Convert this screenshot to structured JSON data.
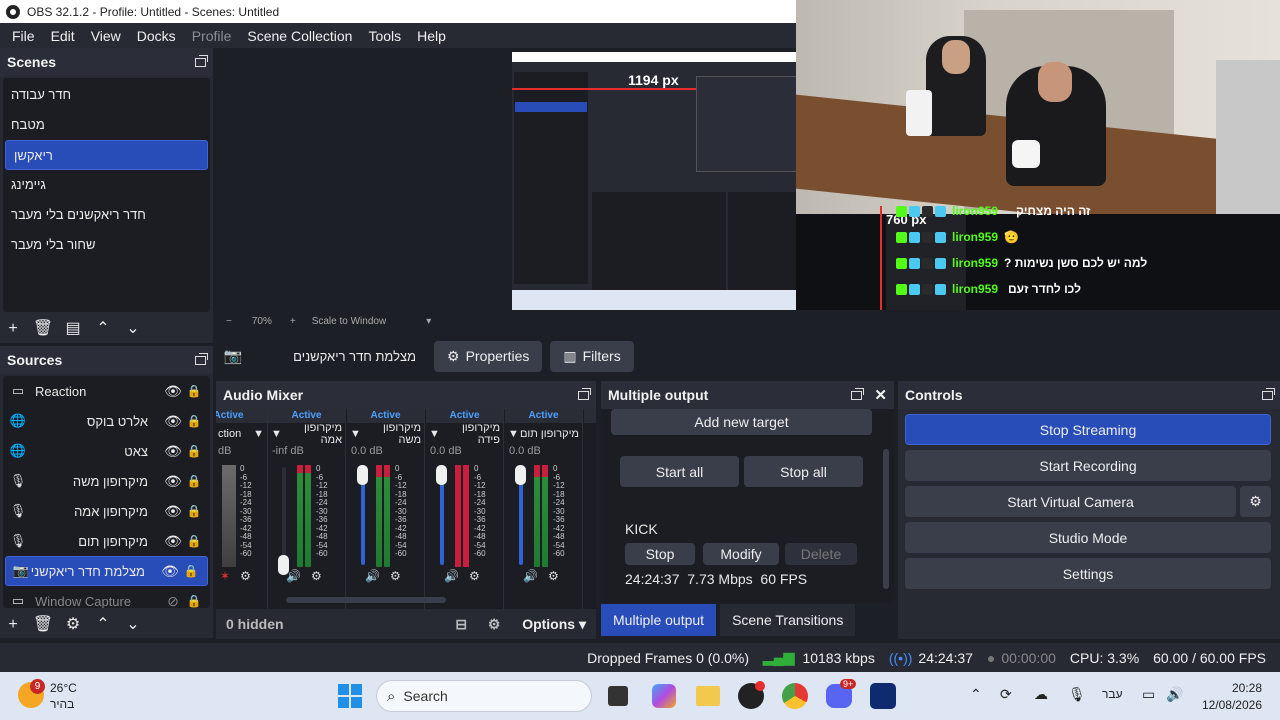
{
  "window": {
    "title": "OBS 32.1.2 - Profile: Untitled - Scenes: Untitled"
  },
  "menu": [
    "File",
    "Edit",
    "View",
    "Docks",
    "Profile",
    "Scene Collection",
    "Tools",
    "Help"
  ],
  "scenes": {
    "title": "Scenes",
    "items": [
      "חדר עבודה",
      "מטבח",
      "ריאקשן",
      "גיימינג",
      "חדר ריאקשנים בלי מעבר",
      "שחור בלי מעבר"
    ],
    "selected": 2
  },
  "sources": {
    "title": "Sources",
    "items": [
      {
        "name": "Reaction",
        "icon": "window-icon"
      },
      {
        "name": "אלרט בוקס",
        "icon": "globe-icon"
      },
      {
        "name": "צאט",
        "icon": "globe-icon"
      },
      {
        "name": "מיקרופון משה",
        "icon": "mic-icon"
      },
      {
        "name": "מיקרופון אמה",
        "icon": "mic-icon"
      },
      {
        "name": "מיקרופון תום",
        "icon": "mic-icon"
      },
      {
        "name": "מצלמת חדר ריאקשני",
        "icon": "camera-icon"
      },
      {
        "name": "Window Capture",
        "icon": "window-icon"
      }
    ],
    "selected": 6
  },
  "preview": {
    "zoom": "70%",
    "zoom_mode": "Scale to Window",
    "measure_w": "1194 px",
    "measure_h": "760 px"
  },
  "source_toolbar": {
    "source_name": "מצלמת חדר ריאקשנים",
    "properties": "Properties",
    "filters": "Filters"
  },
  "mixer": {
    "title": "Audio Mixer",
    "channels": [
      {
        "name": "ction",
        "active": "Active",
        "db": "dB"
      },
      {
        "name": "מיקרופון אמה",
        "active": "Active",
        "db": "-inf dB"
      },
      {
        "name": "מיקרופון משה",
        "active": "Active",
        "db": "0.0 dB"
      },
      {
        "name": "מיקרופון פידה",
        "active": "Active",
        "db": "0.0 dB"
      },
      {
        "name": "מיקרופון תום",
        "active": "Active",
        "db": "0.0 dB"
      },
      {
        "name": "בה",
        "active": "",
        "db": ""
      }
    ],
    "scale": [
      "0",
      "-6",
      "-12",
      "-18",
      "-24",
      "-30",
      "-36",
      "-42",
      "-48",
      "-54",
      "-60"
    ],
    "hidden": "0 hidden",
    "options": "Options"
  },
  "multi_output": {
    "title": "Multiple output",
    "add_target": "Add new target",
    "start_all": "Start all",
    "stop_all": "Stop all",
    "target_name": "KICK",
    "stop": "Stop",
    "modify": "Modify",
    "delete": "Delete",
    "stats": "24:24:37  7.73 Mbps  60 FPS"
  },
  "controls": {
    "title": "Controls",
    "stop_streaming": "Stop Streaming",
    "start_recording": "Start Recording",
    "start_virtual_camera": "Start Virtual Camera",
    "studio_mode": "Studio Mode",
    "settings": "Settings"
  },
  "tabs": {
    "multiple_output": "Multiple output",
    "scene_transitions": "Scene Transitions"
  },
  "status": {
    "dropped": "Dropped Frames 0 (0.0%)",
    "bitrate": "10183 kbps",
    "stream_time": "24:24:37",
    "rec_time": "00:00:00",
    "cpu": "CPU: 3.3%",
    "fps": "60.00 / 60.00 FPS"
  },
  "chat": [
    {
      "user": "liron959",
      "msg": "זה היה מצחיק"
    },
    {
      "user": "liron959",
      "msg": "🫡"
    },
    {
      "user": "liron959",
      "msg": "למה יש לכם סשן נשימות ?"
    },
    {
      "user": "liron959",
      "msg": "לכו לחדר זעם"
    }
  ],
  "taskbar": {
    "weather_temp": "26°C",
    "weather_desc": "בהיר",
    "weather_badge": "9",
    "search": "Search",
    "lang": "עבר",
    "time": "20:28",
    "date": "12/08/2026",
    "discord_badge": "9+"
  },
  "colors": {
    "accent": "#284cb8",
    "live_green": "#2fae3a",
    "meter_red": "#c8203c"
  }
}
